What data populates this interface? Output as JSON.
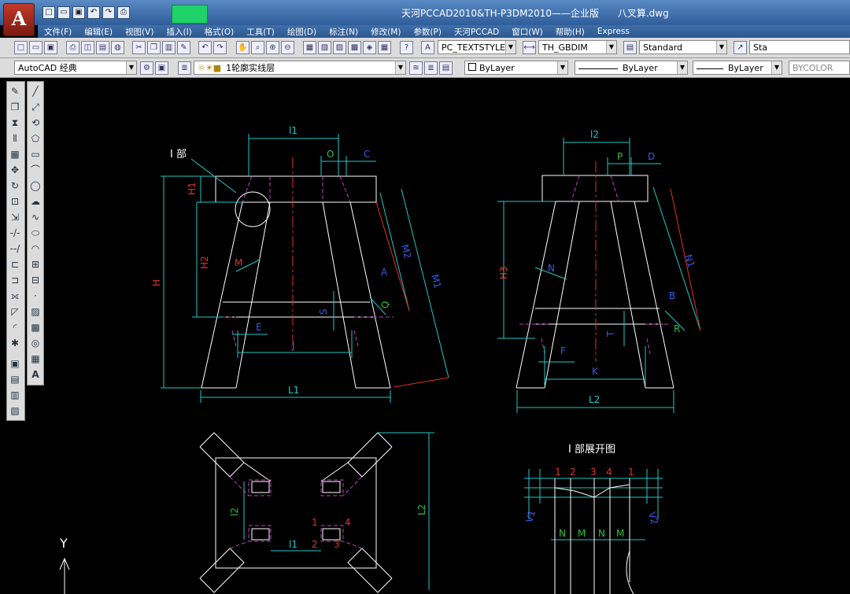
{
  "window": {
    "title_parts": [
      "天河PCCAD2010&TH-P3DM2010——企业版",
      "八叉算.dwg"
    ],
    "app_letter": "A"
  },
  "menus": [
    "文件(F)",
    "编辑(E)",
    "视图(V)",
    "插入(I)",
    "格式(O)",
    "工具(T)",
    "绘图(D)",
    "标注(N)",
    "修改(M)",
    "参数(P)",
    "天河PCCAD",
    "窗口(W)",
    "帮助(H)",
    "Express"
  ],
  "toolbar1": {
    "text_style": "PC_TEXTSTYLE",
    "dim_style": "TH_GBDIM",
    "table_style": "Standard",
    "style_overflow": "Sta"
  },
  "toolbar2": {
    "workspace": "AutoCAD 经典",
    "layer": "1轮廓实线层",
    "color": "ByLayer",
    "linetype": "ByLayer",
    "lineweight": "ByLayer",
    "plotstyle": "BYCOLOR"
  },
  "colors": {
    "title_bar": "#3a6aa6",
    "canvas": "#000000",
    "outline": "#ffffff",
    "dimension": "#22c8c8",
    "center": "#e03020",
    "hidden": "#c040c0",
    "label_red": "#e03030",
    "label_blue": "#3a5ae8",
    "label_green": "#30c040"
  },
  "drawing": {
    "front_view": {
      "dims": [
        "l1",
        "O",
        "C",
        "H1",
        "H2",
        "H",
        "M",
        "M1",
        "M2",
        "A",
        "Q",
        "S",
        "E",
        "J",
        "L1"
      ],
      "detail_label": "I 部"
    },
    "side_view": {
      "dims": [
        "l2",
        "P",
        "D",
        "H3",
        "N",
        "N1",
        "B",
        "R",
        "T",
        "F",
        "K",
        "L2"
      ]
    },
    "top_view": {
      "dims": [
        "l2",
        "l1",
        "L2",
        "1",
        "2",
        "3",
        "4"
      ]
    },
    "development": {
      "title": "I 部展开图",
      "numbers": [
        "1",
        "2",
        "3",
        "4",
        "1"
      ],
      "segments": [
        "N",
        "M",
        "N",
        "M"
      ],
      "side_labels": [
        "V1",
        "V2"
      ]
    },
    "ucs": "Y"
  }
}
